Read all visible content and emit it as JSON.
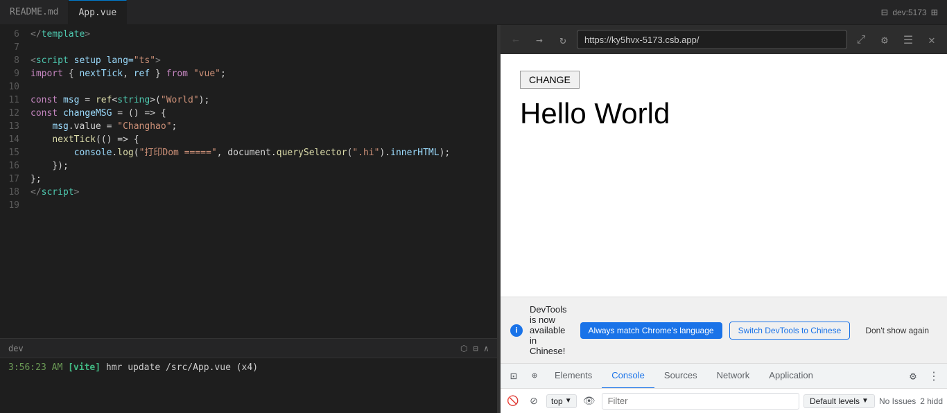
{
  "editor": {
    "tabs": [
      {
        "label": "README.md",
        "active": false
      },
      {
        "label": "App.vue",
        "active": true
      }
    ],
    "lines": [
      {
        "num": 6,
        "tokens": [
          {
            "t": "</",
            "c": "punct"
          },
          {
            "t": "template",
            "c": "tag"
          },
          {
            "t": ">",
            "c": "punct"
          }
        ]
      },
      {
        "num": 7,
        "tokens": []
      },
      {
        "num": 8,
        "tokens": [
          {
            "t": "<",
            "c": "punct"
          },
          {
            "t": "script",
            "c": "tag"
          },
          {
            "t": " setup",
            "c": "attr"
          },
          {
            "t": " lang=",
            "c": "attr"
          },
          {
            "t": "\"ts\"",
            "c": "str"
          },
          {
            "t": ">",
            "c": "punct"
          }
        ]
      },
      {
        "num": 9,
        "tokens": [
          {
            "t": "import",
            "c": "kw2"
          },
          {
            "t": " { ",
            "c": "plain"
          },
          {
            "t": "nextTick",
            "c": "var-name"
          },
          {
            "t": ", ",
            "c": "plain"
          },
          {
            "t": "ref",
            "c": "var-name"
          },
          {
            "t": " } ",
            "c": "plain"
          },
          {
            "t": "from",
            "c": "kw2"
          },
          {
            "t": " ",
            "c": "plain"
          },
          {
            "t": "\"vue\"",
            "c": "str"
          },
          {
            "t": ";",
            "c": "plain"
          }
        ]
      },
      {
        "num": 10,
        "tokens": []
      },
      {
        "num": 11,
        "tokens": [
          {
            "t": "const",
            "c": "kw2"
          },
          {
            "t": " ",
            "c": "plain"
          },
          {
            "t": "msg",
            "c": "var-name"
          },
          {
            "t": " = ",
            "c": "plain"
          },
          {
            "t": "ref",
            "c": "fn"
          },
          {
            "t": "<",
            "c": "plain"
          },
          {
            "t": "string",
            "c": "type"
          },
          {
            "t": ">(",
            "c": "plain"
          },
          {
            "t": "\"World\"",
            "c": "str"
          },
          {
            "t": ");",
            "c": "plain"
          }
        ]
      },
      {
        "num": 12,
        "tokens": [
          {
            "t": "const",
            "c": "kw2"
          },
          {
            "t": " ",
            "c": "plain"
          },
          {
            "t": "changeMSG",
            "c": "var-name"
          },
          {
            "t": " = () =",
            "c": "plain"
          },
          {
            "t": ">",
            "c": "plain"
          },
          {
            "t": " {",
            "c": "plain"
          }
        ]
      },
      {
        "num": 13,
        "tokens": [
          {
            "t": "    ",
            "c": "plain"
          },
          {
            "t": "msg",
            "c": "var-name"
          },
          {
            "t": ".value = ",
            "c": "plain"
          },
          {
            "t": "\"Changhao\"",
            "c": "str"
          },
          {
            "t": ";",
            "c": "plain"
          }
        ]
      },
      {
        "num": 14,
        "tokens": [
          {
            "t": "    ",
            "c": "plain"
          },
          {
            "t": "nextTick",
            "c": "fn"
          },
          {
            "t": "(() =",
            "c": "plain"
          },
          {
            "t": ">",
            "c": "plain"
          },
          {
            "t": " {",
            "c": "plain"
          }
        ]
      },
      {
        "num": 15,
        "tokens": [
          {
            "t": "        ",
            "c": "plain"
          },
          {
            "t": "console",
            "c": "var-name"
          },
          {
            "t": ".",
            "c": "plain"
          },
          {
            "t": "log",
            "c": "fn"
          },
          {
            "t": "(",
            "c": "plain"
          },
          {
            "t": "\"打印Dom =====\"",
            "c": "str"
          },
          {
            "t": ", document.",
            "c": "plain"
          },
          {
            "t": "querySelector",
            "c": "fn"
          },
          {
            "t": "(",
            "c": "plain"
          },
          {
            "t": "\".hi\"",
            "c": "str"
          },
          {
            "t": ").",
            "c": "plain"
          },
          {
            "t": "innerHTML",
            "c": "var-name"
          },
          {
            "t": ");",
            "c": "plain"
          }
        ]
      },
      {
        "num": 16,
        "tokens": [
          {
            "t": "    ",
            "c": "plain"
          },
          {
            "t": "});",
            "c": "plain"
          }
        ]
      },
      {
        "num": 17,
        "tokens": [
          {
            "t": "};",
            "c": "plain"
          }
        ]
      },
      {
        "num": 18,
        "tokens": [
          {
            "t": "</",
            "c": "punct"
          },
          {
            "t": "script",
            "c": "tag"
          },
          {
            "t": ">",
            "c": "punct"
          }
        ]
      },
      {
        "num": 19,
        "tokens": []
      }
    ]
  },
  "terminal": {
    "title": "dev",
    "log_line": "3:56:23 AM [vite] hmr update /src/App.vue (x4)"
  },
  "browser": {
    "url": "https://ky5hvx-5173.csb.app/",
    "change_button": "CHANGE",
    "hello_world": "Hello World",
    "devtools_notification": "DevTools is now available in Chinese!",
    "btn_always_match": "Always match Chrome's language",
    "btn_switch_chinese": "Switch DevTools to Chinese",
    "btn_dont_show": "Don't show again",
    "tabs": [
      {
        "label": "Elements",
        "active": false
      },
      {
        "label": "Console",
        "active": true
      },
      {
        "label": "Sources",
        "active": false
      },
      {
        "label": "Network",
        "active": false
      },
      {
        "label": "Application",
        "active": false
      }
    ],
    "console_top": "top",
    "console_filter_placeholder": "Filter",
    "console_default_levels": "Default levels",
    "no_issues": "No Issues",
    "hidden_count": "2 hidd"
  }
}
